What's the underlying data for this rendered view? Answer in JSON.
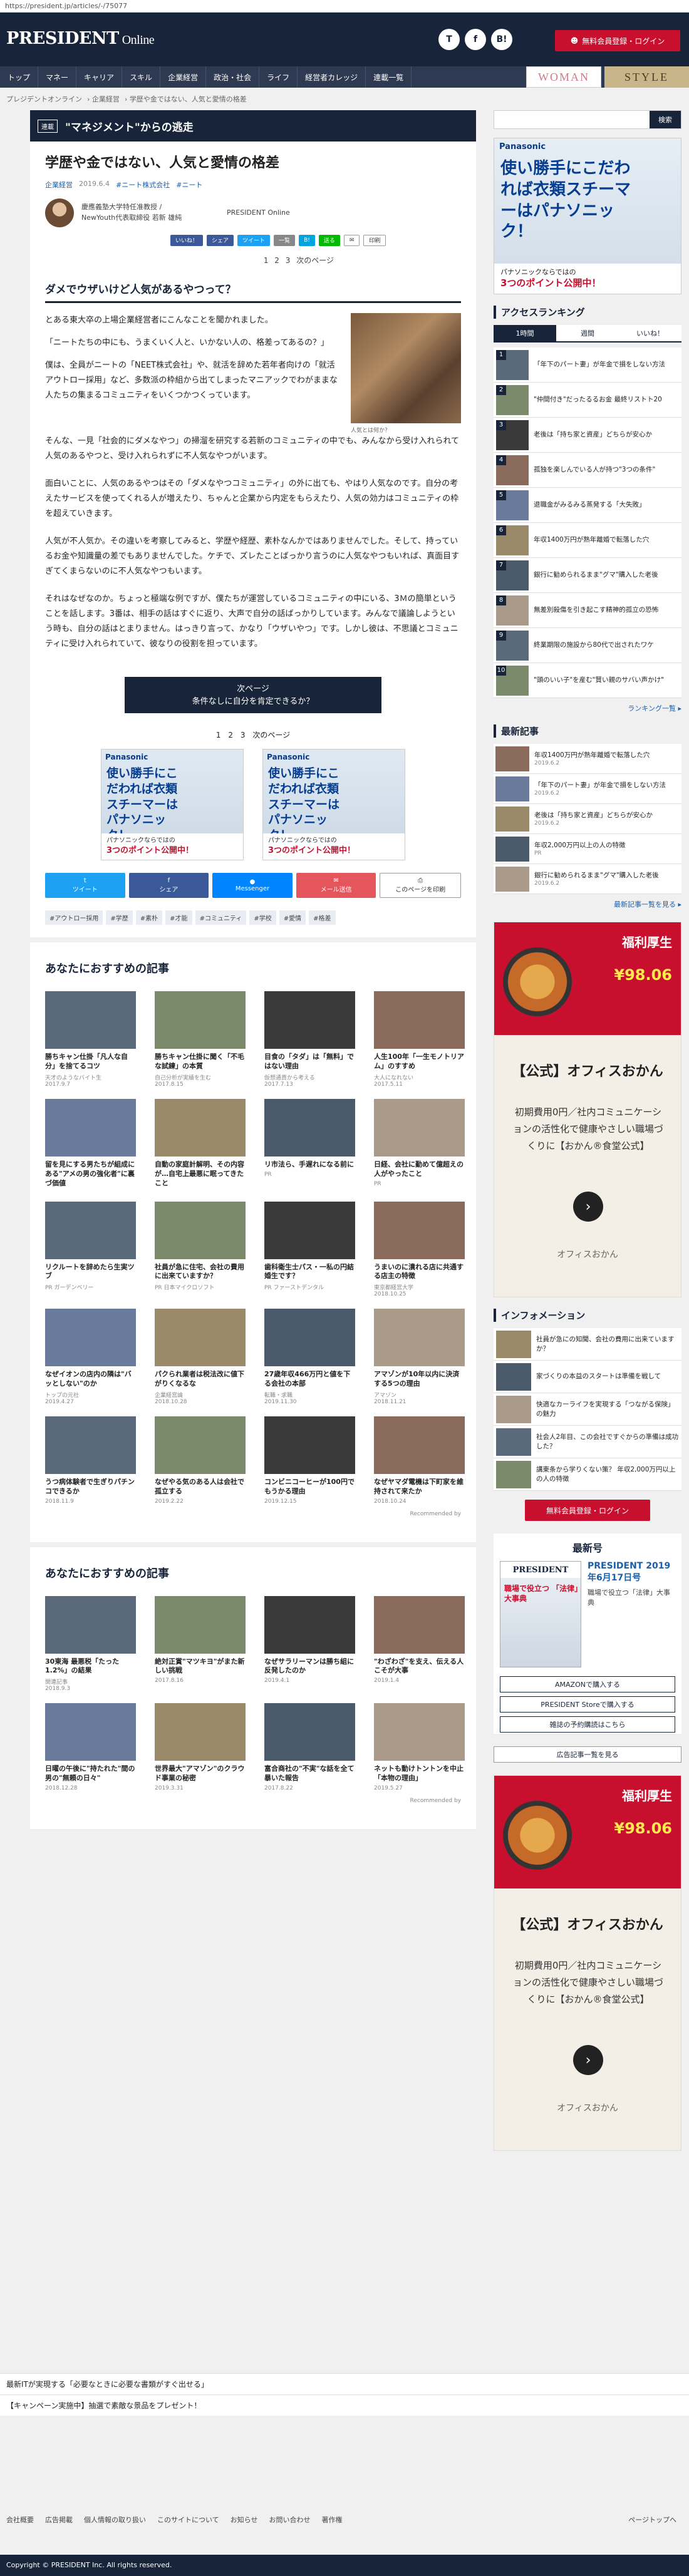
{
  "url": "https://president.jp/articles/-/75077",
  "header": {
    "logo": "PRESIDENT",
    "logo_sub": "Online",
    "icons": [
      "T",
      "f",
      "B!"
    ],
    "login": "無料会員登録・ログイン"
  },
  "nav": [
    "トップ",
    "マネー",
    "キャリア",
    "スキル",
    "企業経営",
    "政治・社会",
    "ライフ",
    "経営者カレッジ",
    "連載一覧"
  ],
  "nav_woman": "WOMAN",
  "nav_style": "STYLE",
  "breadcrumb": [
    "プレジデントオンライン",
    "企業経営",
    "学歴や金ではない、人気と愛情の格差"
  ],
  "serial": {
    "tag": "連載",
    "title": "\"マネジメント\"からの逃走"
  },
  "article": {
    "title": "学歴や金ではない、人気と愛情の格差",
    "cat": "企業経営",
    "date": "2019.6.4",
    "tag2": "#ニート株式会社",
    "tag3": "#ニート",
    "author_name": "慶應義塾大学特任准教授 / NewYouth代表取締役 若新 雄純",
    "publisher": "PRESIDENT Online",
    "share": [
      "いいね！",
      "シェア",
      "ツイート",
      "一覧",
      "B!",
      "送る",
      "印刷"
    ],
    "pager": [
      "1",
      "2",
      "3",
      "次のページ"
    ],
    "h2": "ダメでウザいけど人気があるやつって？",
    "p1": "とある東大卒の上場企業経営者にこんなことを聞かれました。",
    "p2": "「ニートたちの中にも、うまくいく人と、いかない人の、格差ってあるの？」",
    "p3": "僕は、全員がニートの「NEET株式会社」や、就活を辞めた若年者向けの「就活アウトロー採用」など、多数派の枠組から出てしまったマニアックでわがままな人たちの集まるコミュニティをいくつかつくっています。",
    "photo_cap": "人気とは何か？",
    "p4": "そんな、一見「社会的にダメなやつ」の掃溜を研究する若新のコミュニティの中でも、みんなから受け入れられて人気のあるやつと、受け入れられずに不人気なやつがいます。",
    "p5": "面白いことに、人気のあるやつはその「ダメなやつコミュニティ」の外に出ても、やはり人気なのです。自分の考えたサービスを使ってくれる人が増えたり、ちゃんと企業から内定をもらえたり、人気の効力はコミュニティの枠を超えていきます。",
    "p6": "人気が不人気か。その違いを考察してみると、学歴や経歴、素朴なんかではありませんでした。そして、持っているお金や知識量の差でもありませんでした。ケチで、ズレたことばっかり言うのに人気なやつもいれば、真面目すぎてくまらないのに不人気なやつもいます。",
    "p7": "それはなぜなのか。ちょっと極端な例ですが、僕たちが運営しているコミュニティの中にいる、3Ｍの簡単ということを話します。3番は、相手の話はすぐに返り、大声で自分の話ばっかりしています。みんなで議論しようという時も、自分の話はとまりません。はっきり言って、かなり「ウザいやつ」です。しかし彼は、不思議とコミュニティに受け入れられていて、彼なりの役割を担っています。",
    "next_btn": "次ページ",
    "next_sub": "条件なしに自分を肯定できるか？",
    "pager2": [
      "1",
      "2",
      "3",
      "次のページ"
    ],
    "ad": {
      "brand": "Panasonic",
      "big": "使い勝手にこだわれば衣類スチーマーはパナソニック！",
      "bot1": "パナソニックならではの",
      "bot2": "3つのポイント公開中！"
    },
    "sharebar": [
      "ツイート",
      "シェア",
      "Messenger",
      "メール送信",
      "このページを印刷"
    ],
    "tags": [
      "#アウトロー採用",
      "#学歴",
      "#素朴",
      "#才能",
      "#コミュニティ",
      "#学校",
      "#愛情",
      "#格差"
    ]
  },
  "rec1": {
    "title": "あなたにおすすめの記事",
    "items": [
      {
        "t": "勝ちキャン仕掛「凡人な自分」を捨てるコツ",
        "s": "天才のようなバイト生",
        "d": "2017.9.7"
      },
      {
        "t": "勝ちキャン仕掛に聞く「不毛な試練」の本質",
        "s": "自己分析が実績を生む",
        "d": "2017.8.15"
      },
      {
        "t": "目食の「タダ」は「無料」ではない理由",
        "s": "仮想通貨から考える",
        "d": "2017.7.13"
      },
      {
        "t": "人生100年「一生モノトリアム」のすすめ",
        "s": "大人になれない",
        "d": "2017.5.11"
      },
      {
        "t": "留を見にする男たちが組成にある\"アメの男の強化者\"に裏づ価値",
        "s": "",
        "d": ""
      },
      {
        "t": "自動の家庭計解明、その内容が…自宅上最悪に眠ってきたこと",
        "s": "",
        "d": ""
      },
      {
        "t": "リ市法ら、手遅れになる前に",
        "s": "PR",
        "d": ""
      },
      {
        "t": "日経、会社に勤めて億超えの人がやったこと",
        "s": "PR",
        "d": ""
      },
      {
        "t": "リクルートを辞めたら生実ツブ",
        "s": "PR ガーデンベリー",
        "d": ""
      },
      {
        "t": "社員が急に住宅、会社の費用に出来ていますか？",
        "s": "PR 日本マイクロソフト",
        "d": ""
      },
      {
        "t": "歯科衛生士パス・一私の円結婚生です？",
        "s": "PR ファーストデンタル",
        "d": ""
      },
      {
        "t": "うまいのに潰れる店に共通する店主の特徴",
        "s": "東京都経営大学",
        "d": "2018.10.25"
      },
      {
        "t": "なぜイオンの店内の隣は\"バッとしない\"のか",
        "s": "トップの元社",
        "d": "2019.4.27"
      },
      {
        "t": "パクられ業者は税法改に値下がりくなるな",
        "s": "企業経営論",
        "d": "2018.10.28"
      },
      {
        "t": "27歳年収466万円と値を下る会社の本部",
        "s": "転職・求職",
        "d": "2019.11.30"
      },
      {
        "t": "アマゾンが10年以内に決済する5つの理由",
        "s": "アマゾン",
        "d": "2018.11.21"
      },
      {
        "t": "うつ病体験者で生ぎりパチンコできるか",
        "s": "",
        "d": "2018.11.9"
      },
      {
        "t": "なぜやる気のある人は会社で孤立する",
        "s": "",
        "d": "2019.2.22"
      },
      {
        "t": "コンビニコーヒーが100円でもうかる理由",
        "s": "",
        "d": "2019.12.15"
      },
      {
        "t": "なぜヤマダ電機は下町家を維持されて来たか",
        "s": "",
        "d": "2018.10.24"
      }
    ],
    "powered": "Recommended by"
  },
  "rec2": {
    "title": "あなたにおすすめの記事",
    "items": [
      {
        "t": "30東海 最悪税「たった1.2%」の結果",
        "s": "関連記事",
        "d": "2018.9.3"
      },
      {
        "t": "絶対正賞\"マツキヨ\"がまた新しい挑戦",
        "s": "",
        "d": "2017.8.16"
      },
      {
        "t": "なぜサラリーマンは勝ち組に反発したのか",
        "s": "",
        "d": "2019.4.1"
      },
      {
        "t": "\"わざわざ\"を支え、伝える人こそが大事",
        "s": "",
        "d": "2019.1.4"
      },
      {
        "t": "日曜の午後に\"持たれた\"間の男の\"無頼の日々\"",
        "s": "",
        "d": "2018.12.28"
      },
      {
        "t": "世界最大\"アマゾン\"のクラウド事業の秘密",
        "s": "",
        "d": "2019.3.31"
      },
      {
        "t": "富合商社の\"不実\"な話を全て暴いた報告",
        "s": "",
        "d": "2017.8.22"
      },
      {
        "t": "ネットも動けトントンを中止「本物の理由」",
        "s": "",
        "d": "2019.5.27"
      }
    ],
    "powered": "Recommended by"
  },
  "sidebar": {
    "search_btn": "検索",
    "ad": {
      "brand": "Panasonic",
      "big": "使い勝手にこだわれば衣類スチーマーはパナソニック！",
      "bot1": "パナソニックならではの",
      "bot2": "3つのポイント公開中！"
    },
    "ranking_title": "アクセスランキング",
    "ranking_tabs": [
      "1時間",
      "週間",
      "いいね！"
    ],
    "ranking": [
      "「年下のパート妻」が年金で損をしない方法",
      "\"仲間付き\"だったるるお金 最終リストト20",
      "老後は「持ち家と資産」どちらが安心か",
      "孤独を楽しんでいる人が持つ\"3つの条件\"",
      "退職金がみるみる蒸発する「大失敗」",
      "年収1400万円が熟年離婚で転落した穴",
      "銀行に勧められるまま\"グマ\"購入した老後",
      "無差別殺傷を引き起こす精神的孤立の恐怖",
      "終業期限の施設から80代で出されたワケ",
      "\"頭のいい子\"を産む\"賢い親のサバい声かけ\""
    ],
    "ranking_more": "ランキング一覧 ▸",
    "new_title": "最新記事",
    "new": [
      {
        "t": "年収1400万円が熟年離婚で転落した穴",
        "d": "2019.6.2"
      },
      {
        "t": "「年下のパート妻」が年金で損をしない方法",
        "d": "2019.6.2"
      },
      {
        "t": "老後は「持ち家と資産」どちらが安心か",
        "d": "2019.6.2"
      },
      {
        "t": "年収2,000万円以上の人の特徴",
        "d": "PR"
      },
      {
        "t": "銀行に勧められるまま\"グマ\"購入した老後",
        "d": "2019.6.2"
      }
    ],
    "new_more": "最新記事一覧を見る ▸",
    "okan": {
      "ribbon": "福利厚生",
      "price": "¥98.06",
      "b1": "【公式】オフィスおかん",
      "b2": "初期費用0円／社内コミュニケーションの活性化で健康やさしい職場づくりに【おかん®食堂公式】",
      "name": "オフィスおかん"
    },
    "info_title": "インフォメーション",
    "info": [
      "社員が急にの知聞、会社の費用に出来ていますか？",
      "家づくりの本益のスタートは準備を戦して",
      "快適なカーライフを実現する「つながる保険」の魅力",
      "社会人2年目、この会社ですぐからの準備は成功した？",
      "講東条から学りくない策？ 年収2,000万円以上の人の特徴"
    ],
    "login": "無料会員登録・ログイン",
    "latest_title": "最新号",
    "cover_logo": "PRESIDENT",
    "cover_head": "職場で役立つ\n「法律」大事典",
    "issue": "PRESIDENT 2019年6月17日号",
    "issue_desc": "職場で役立つ「法律」大事典",
    "buy": [
      "AMAZONで購入する",
      "PRESIDENT Storeで購入する",
      "雑誌の予約購読はこちら"
    ],
    "ad_list": "広告記事一覧を見る"
  },
  "footer": {
    "links": [
      "最新ITが実現する「必要なときに必要な書類がすぐ出せる」",
      "【キャンペーン実施中】抽選で素敵な景品をプレゼント！"
    ],
    "nav": [
      "会社概要",
      "広告掲載",
      "個人情報の取り扱い",
      "このサイトについて",
      "お知らせ",
      "お問い合わせ",
      "著作権",
      "ページトップへ"
    ],
    "copyright": "Copyright © PRESIDENT Inc. All rights reserved."
  }
}
